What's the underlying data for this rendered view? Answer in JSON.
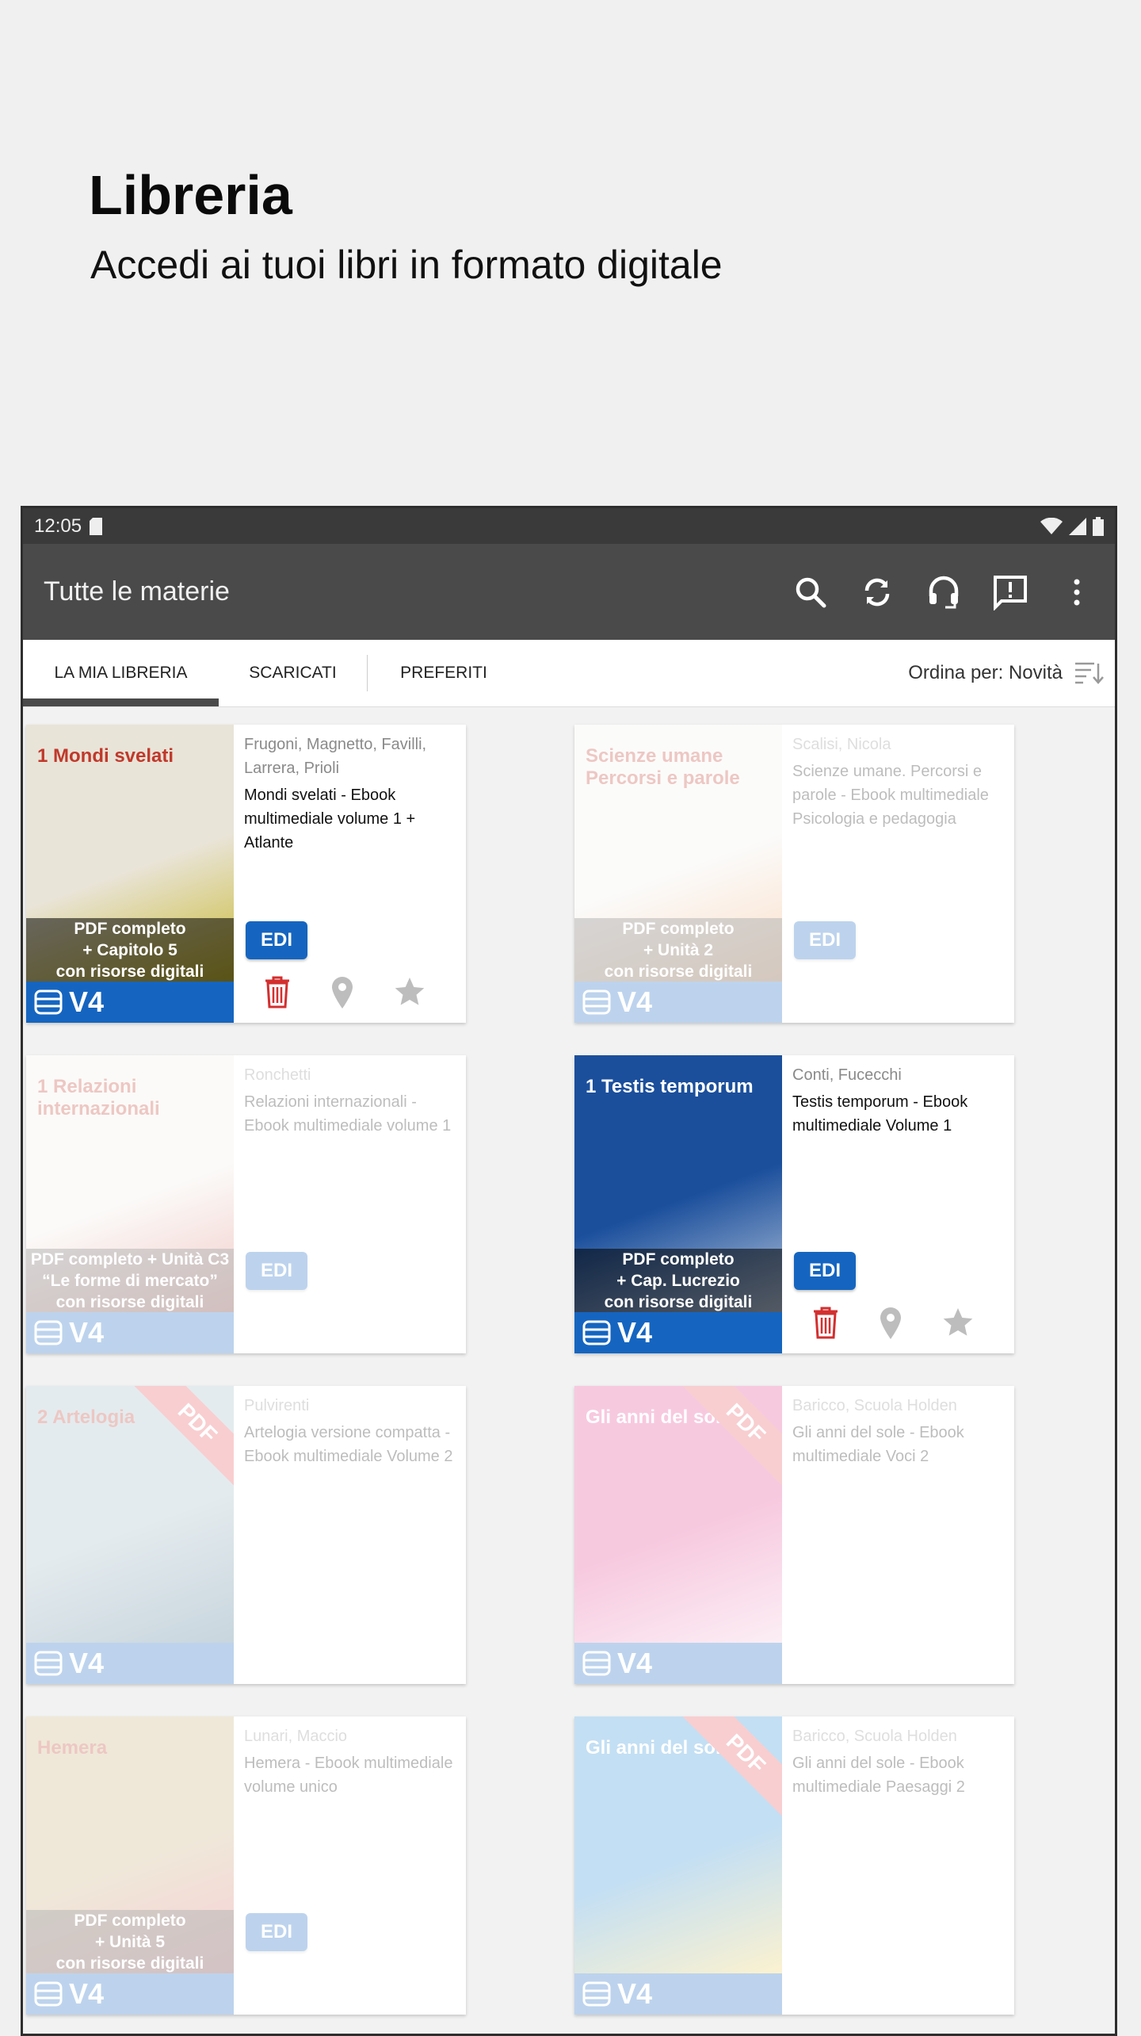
{
  "promo": {
    "title": "Libreria",
    "subtitle": "Accedi ai tuoi libri in formato digitale"
  },
  "status_bar": {
    "time": "12:05"
  },
  "app_bar": {
    "title": "Tutte le materie",
    "actions": [
      "search-icon",
      "sync-icon",
      "headset-icon",
      "feedback-icon",
      "more-vert-icon"
    ]
  },
  "tabs": {
    "items": [
      {
        "label": "LA MIA LIBRERIA",
        "active": true
      },
      {
        "label": "SCARICATI",
        "active": false
      },
      {
        "label": "PREFERITI",
        "active": false
      }
    ],
    "sort_label": "Ordina per: Novità"
  },
  "books": [
    {
      "authors": "Frugoni, Magnetto, Favilli, Larrera, Prioli",
      "title": "Mondi svelati - Ebook multimediale volume 1 + Atlante",
      "cover_title": "1 Mondi svelati",
      "caption": [
        "PDF completo",
        "+ Capitolo 5",
        "con risorse digitali"
      ],
      "version": "V4",
      "edi": "EDI",
      "pdf": false,
      "faded": false,
      "cover_color": "#e9e4d8",
      "accent": "#c8b830"
    },
    {
      "authors": "Scalisi, Nicola",
      "title": "Scienze umane. Percorsi e parole - Ebook multimediale Psicologia e pedagogia",
      "cover_title": "Scienze umane Percorsi e parole",
      "caption": [
        "PDF completo",
        "+ Unità 2",
        "con risorse digitali"
      ],
      "version": "V4",
      "edi": "EDI",
      "pdf": false,
      "faded": true,
      "cover_color": "#f4f2ee",
      "accent": "#f08a3a"
    },
    {
      "authors": "Ronchetti",
      "title": "Relazioni internazionali - Ebook multimediale volume 1",
      "cover_title": "1 Relazioni internazionali",
      "caption": [
        "PDF completo + Unità C3",
        "“Le forme di mercato”",
        "con risorse digitali"
      ],
      "version": "V4",
      "edi": "EDI",
      "pdf": false,
      "faded": true,
      "cover_color": "#f3efe9",
      "accent": "#d0473c"
    },
    {
      "authors": "Conti, Fucecchi",
      "title": "Testis temporum - Ebook multimediale Volume 1",
      "cover_title": "1 Testis temporum",
      "caption": [
        "PDF completo",
        "+ Cap. Lucrezio",
        "con risorse digitali"
      ],
      "version": "V4",
      "edi": "EDI",
      "pdf": false,
      "faded": false,
      "cover_color": "#1b4f9c",
      "accent": "#b9c8dd"
    },
    {
      "authors": "Pulvirenti",
      "title": "Artelogia versione compatta - Ebook multimediale Volume 2",
      "cover_title": "2 Artelogia",
      "caption": [],
      "version": "V4",
      "edi": "",
      "pdf": true,
      "faded": true,
      "cover_color": "#9fb8c4",
      "accent": "#3d6d8a"
    },
    {
      "authors": "Baricco, Scuola Holden",
      "title": "Gli anni del sole - Ebook multimediale Voci 2",
      "cover_title": "Gli anni del sole",
      "caption": [],
      "version": "V4",
      "edi": "",
      "pdf": true,
      "faded": true,
      "cover_color": "#e43f8f",
      "accent": "#f5c5dc"
    },
    {
      "authors": "Lunari, Maccio",
      "title": "Hemera - Ebook multimediale volume unico",
      "cover_title": "Hemera",
      "caption": [
        "PDF completo",
        "+ Unità 5",
        "con risorse digitali"
      ],
      "version": "V4",
      "edi": "EDI",
      "pdf": false,
      "faded": true,
      "cover_color": "#c8b07a",
      "accent": "#e35a6a"
    },
    {
      "authors": "Baricco, Scuola Holden",
      "title": "Gli anni del sole - Ebook multimediale Paesaggi 2",
      "cover_title": "Gli anni del sole",
      "caption": [],
      "version": "V4",
      "edi": "",
      "pdf": true,
      "faded": true,
      "cover_color": "#2d8fd6",
      "accent": "#f3d25a"
    }
  ],
  "labels": {
    "pdf_ribbon": "PDF"
  },
  "colors": {
    "primary": "#1565c0",
    "appbar": "#4a4a4a",
    "delete": "#d32f2f",
    "pdf": "#e8545b"
  }
}
